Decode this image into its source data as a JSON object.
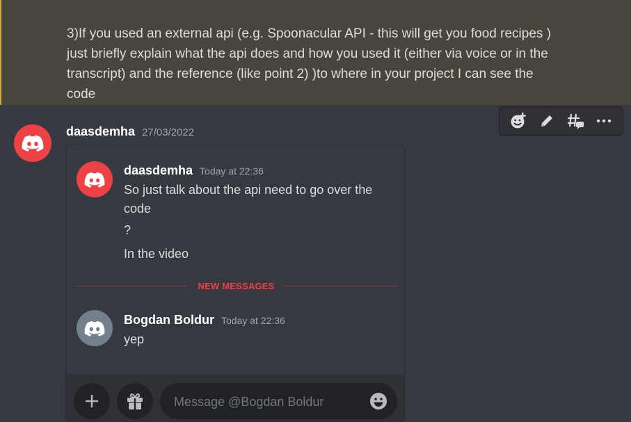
{
  "quoted_message": {
    "text_lines": [
      "3)If you used an external api (e.g. Spoonacular API - this will get you  food recipes )",
      "just briefly explain what the api does and how you used it (either via voice or in the",
      "transcript) and the reference (like point 2) )to where in your project I can see the",
      "code"
    ]
  },
  "toolbar": {
    "icons": [
      "add-reaction-icon",
      "edit-icon",
      "thread-icon",
      "more-icon"
    ]
  },
  "outer_message": {
    "author": "daasdemha",
    "timestamp": "27/03/2022",
    "avatar_color": "#ed4245"
  },
  "embedded_chat": {
    "messages": [
      {
        "author": "daasdemha",
        "timestamp": "Today at 22:36",
        "avatar_color": "#ed4245",
        "lines": [
          "So just talk about the api need to go over the code",
          "?",
          "In the video"
        ]
      },
      {
        "author": "Bogdan Boldur",
        "timestamp": "Today at 22:36",
        "avatar_color": "#747f8d",
        "lines": [
          "yep"
        ]
      }
    ],
    "divider_label": "NEW MESSAGES",
    "composer": {
      "placeholder": "Message @Bogdan Boldur",
      "icons": [
        "plus-icon",
        "gift-icon",
        "emoji-icon"
      ]
    }
  },
  "colors": {
    "background": "#36393f",
    "quote_background": "#48453c",
    "accent_red": "#ed4245",
    "text": "#dcddde",
    "muted": "#a3a6aa"
  }
}
